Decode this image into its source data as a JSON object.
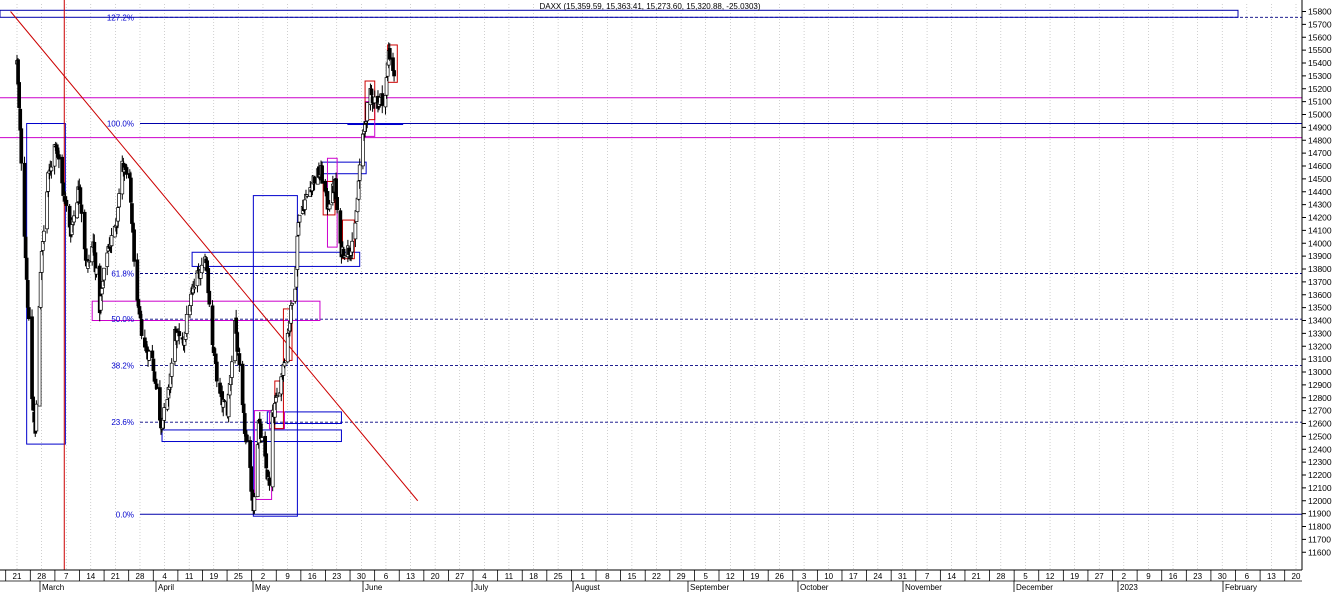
{
  "chart_data": {
    "type": "candlestick",
    "header": "DAXX (15,359.59, 15,363.41, 15,273.60, 15,320.88, -25.0303)",
    "ylim": [
      11550,
      15850
    ],
    "y_ticks": [
      11600,
      11700,
      11800,
      11900,
      12000,
      12100,
      12200,
      12300,
      12400,
      12500,
      12600,
      12700,
      12800,
      12900,
      13000,
      13100,
      13200,
      13300,
      13400,
      13500,
      13600,
      13700,
      13800,
      13900,
      14000,
      14100,
      14200,
      14300,
      14400,
      14500,
      14600,
      14700,
      14800,
      14900,
      15000,
      15100,
      15200,
      15300,
      15400,
      15500,
      15600,
      15700,
      15800
    ],
    "x_day_labels": [
      "21",
      "28",
      "7",
      "14",
      "21",
      "28",
      "4",
      "11",
      "19",
      "25",
      "2",
      "9",
      "16",
      "23",
      "30",
      "6",
      "13",
      "20",
      "27",
      "4",
      "11",
      "18",
      "25",
      "1",
      "8",
      "15",
      "22",
      "29",
      "5",
      "12",
      "19",
      "26",
      "3",
      "10",
      "17",
      "24",
      "31",
      "7",
      "14",
      "21",
      "28",
      "5",
      "12",
      "19",
      "27",
      "2",
      "9",
      "16",
      "23",
      "30",
      "6",
      "13",
      "20"
    ],
    "x_month_labels": [
      "March",
      "April",
      "May",
      "June",
      "July",
      "August",
      "September",
      "October",
      "November",
      "December",
      "2023",
      "February"
    ],
    "grid": true,
    "fibonacci_levels": [
      {
        "label": "127.2%",
        "value": 15755
      },
      {
        "label": "100.0%",
        "value": 14930
      },
      {
        "label": "61.8%",
        "value": 13765
      },
      {
        "label": "50.0%",
        "value": 13410
      },
      {
        "label": "38.2%",
        "value": 13050
      },
      {
        "label": "23.6%",
        "value": 12610
      },
      {
        "label": "0.0%",
        "value": 11895
      }
    ],
    "horizontal_lines": [
      {
        "value": 15130,
        "color": "#cc00cc"
      },
      {
        "value": 14820,
        "color": "#cc00cc"
      }
    ],
    "trendline": {
      "color": "#cc0000",
      "from": [
        "2022-02-15",
        15800
      ],
      "to": [
        "2023-03-01",
        12000
      ]
    },
    "vertical_line": {
      "date": "2022-04-06",
      "color": "#cc0000"
    },
    "boxes": [
      {
        "color": "#0000cc",
        "from": [
          "2022-03-02",
          14930
        ],
        "to": [
          "2022-04-07",
          12440
        ]
      },
      {
        "color": "#cc00cc",
        "from": [
          "2022-05-02",
          13550
        ],
        "to": [
          "2022-11-30",
          13400
        ]
      },
      {
        "color": "#0000cc",
        "from": [
          "2022-07-06",
          12550
        ],
        "to": [
          "2022-12-20",
          12460
        ]
      },
      {
        "color": "#0000cc",
        "from": [
          "2022-08-03",
          13930
        ],
        "to": [
          "2023-01-06",
          13820
        ]
      },
      {
        "color": "#0000cc",
        "from": [
          "2022-09-29",
          14370
        ],
        "to": [
          "2022-11-09",
          11880
        ]
      },
      {
        "color": "#0000cc",
        "from": [
          "2022-10-12",
          12690
        ],
        "to": [
          "2022-12-20",
          12600
        ]
      },
      {
        "color": "#0000cc",
        "from": [
          "2022-12-01",
          14630
        ],
        "to": [
          "2023-01-12",
          14540
        ]
      },
      {
        "color": "#0000cc",
        "from": [
          "2022-12-26",
          14930
        ],
        "to": [
          "2023-02-15",
          14930
        ]
      },
      {
        "color": "#cc00cc",
        "from": [
          "2022-09-30",
          12700
        ],
        "to": [
          "2022-10-16",
          12010
        ]
      },
      {
        "color": "#cc00cc",
        "from": [
          "2022-10-14",
          12690
        ],
        "to": [
          "2022-10-28",
          12560
        ]
      },
      {
        "color": "#cc00cc",
        "from": [
          "2022-12-07",
          14660
        ],
        "to": [
          "2022-12-16",
          13970
        ]
      },
      {
        "color": "#cc00cc",
        "from": [
          "2023-01-11",
          15100
        ],
        "to": [
          "2023-01-20",
          14830
        ]
      },
      {
        "color": "#cc0000",
        "from": [
          "2022-10-19",
          12930
        ],
        "to": [
          "2022-10-27",
          12560
        ]
      },
      {
        "color": "#cc0000",
        "from": [
          "2022-10-27",
          13490
        ],
        "to": [
          "2022-11-04",
          13090
        ]
      },
      {
        "color": "#cc0000",
        "from": [
          "2022-12-03",
          14480
        ],
        "to": [
          "2022-12-14",
          14220
        ]
      },
      {
        "color": "#cc0000",
        "from": [
          "2022-12-21",
          14180
        ],
        "to": [
          "2023-01-01",
          13880
        ]
      },
      {
        "color": "#cc0000",
        "from": [
          "2023-01-11",
          15260
        ],
        "to": [
          "2023-01-20",
          14960
        ]
      },
      {
        "color": "#cc0000",
        "from": [
          "2023-02-01",
          15540
        ],
        "to": [
          "2023-02-10",
          15250
        ]
      }
    ],
    "closes": [
      {
        "date": "2022-02-21",
        "close": 15400
      },
      {
        "date": "2022-03-07",
        "close": 12800
      },
      {
        "date": "2022-03-10",
        "close": 12500
      },
      {
        "date": "2022-03-15",
        "close": 13800
      },
      {
        "date": "2022-03-22",
        "close": 14500
      },
      {
        "date": "2022-03-29",
        "close": 14800
      },
      {
        "date": "2022-04-05",
        "close": 14400
      },
      {
        "date": "2022-04-12",
        "close": 14100
      },
      {
        "date": "2022-04-20",
        "close": 14450
      },
      {
        "date": "2022-04-27",
        "close": 13800
      },
      {
        "date": "2022-05-03",
        "close": 14000
      },
      {
        "date": "2022-05-09",
        "close": 13500
      },
      {
        "date": "2022-05-16",
        "close": 13950
      },
      {
        "date": "2022-05-23",
        "close": 14100
      },
      {
        "date": "2022-05-30",
        "close": 14600
      },
      {
        "date": "2022-06-06",
        "close": 14450
      },
      {
        "date": "2022-06-13",
        "close": 13500
      },
      {
        "date": "2022-06-20",
        "close": 13200
      },
      {
        "date": "2022-06-27",
        "close": 13100
      },
      {
        "date": "2022-07-05",
        "close": 12600
      },
      {
        "date": "2022-07-11",
        "close": 12750
      },
      {
        "date": "2022-07-18",
        "close": 13300
      },
      {
        "date": "2022-07-25",
        "close": 13200
      },
      {
        "date": "2022-08-01",
        "close": 13550
      },
      {
        "date": "2022-08-08",
        "close": 13750
      },
      {
        "date": "2022-08-16",
        "close": 13900
      },
      {
        "date": "2022-08-22",
        "close": 13200
      },
      {
        "date": "2022-08-29",
        "close": 12800
      },
      {
        "date": "2022-09-05",
        "close": 12700
      },
      {
        "date": "2022-09-12",
        "close": 13400
      },
      {
        "date": "2022-09-19",
        "close": 12700
      },
      {
        "date": "2022-09-26",
        "close": 12200
      },
      {
        "date": "2022-09-29",
        "close": 11950
      },
      {
        "date": "2022-10-04",
        "close": 12600
      },
      {
        "date": "2022-10-10",
        "close": 12300
      },
      {
        "date": "2022-10-14",
        "close": 12100
      },
      {
        "date": "2022-10-17",
        "close": 12650
      },
      {
        "date": "2022-10-24",
        "close": 12900
      },
      {
        "date": "2022-10-31",
        "close": 13300
      },
      {
        "date": "2022-11-07",
        "close": 13700
      },
      {
        "date": "2022-11-10",
        "close": 14200
      },
      {
        "date": "2022-11-17",
        "close": 14350
      },
      {
        "date": "2022-11-24",
        "close": 14500
      },
      {
        "date": "2022-12-01",
        "close": 14550
      },
      {
        "date": "2022-12-07",
        "close": 14300
      },
      {
        "date": "2022-12-14",
        "close": 14450
      },
      {
        "date": "2022-12-19",
        "close": 13950
      },
      {
        "date": "2022-12-27",
        "close": 13950
      },
      {
        "date": "2023-01-02",
        "close": 14100
      },
      {
        "date": "2023-01-06",
        "close": 14600
      },
      {
        "date": "2023-01-12",
        "close": 15000
      },
      {
        "date": "2023-01-16",
        "close": 15150
      },
      {
        "date": "2023-01-23",
        "close": 15100
      },
      {
        "date": "2023-01-30",
        "close": 15150
      },
      {
        "date": "2023-02-02",
        "close": 15500
      },
      {
        "date": "2023-02-07",
        "close": 15320
      }
    ]
  }
}
